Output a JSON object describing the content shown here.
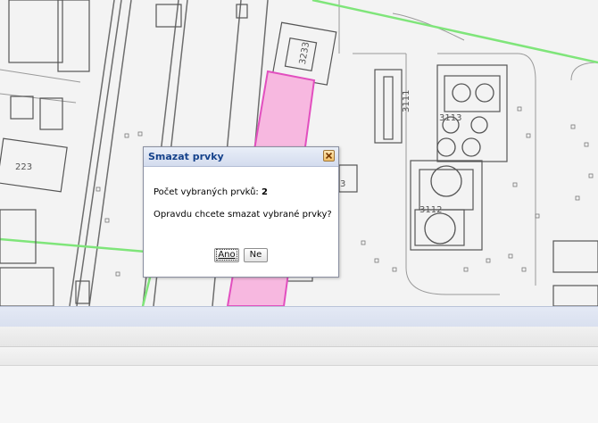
{
  "map": {
    "labels": {
      "building_3233": "3233",
      "building_3111": "3111",
      "building_3113": "3113",
      "building_3112": "3112",
      "building_223": "223",
      "building_3_partial": "3"
    }
  },
  "dialog": {
    "title": "Smazat prvky",
    "count_label": "Počet vybraných prvků:",
    "count_value": "2",
    "question": "Opravdu chcete smazat vybrané prvky?",
    "yes_label": "Ano",
    "no_label": "Ne",
    "close_icon": "close-icon"
  },
  "colors": {
    "selection_fill": "#f7b8e0",
    "selection_stroke": "#e24fbf",
    "boundary_green": "#7fe57a",
    "dialog_title": "#15428b"
  }
}
